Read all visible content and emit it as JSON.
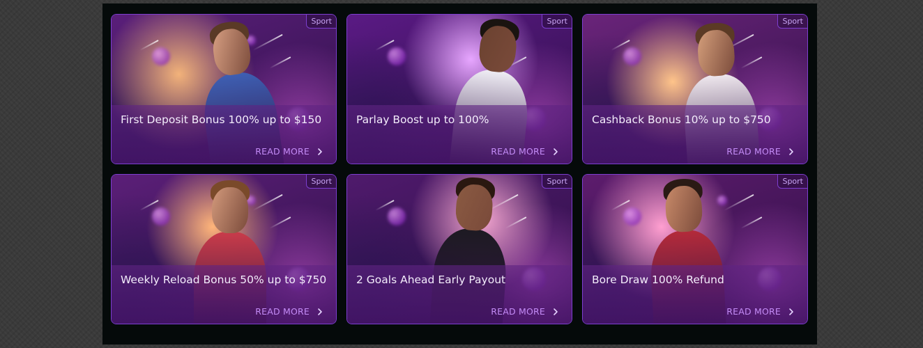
{
  "promotions": [
    {
      "tag": "Sport",
      "title": "First Deposit Bonus 100% up to $150",
      "cta": "READ MORE",
      "chevron_icon": "chevron-right-icon",
      "scene": "soccer player",
      "colors": {
        "bg": "#5a1f7a",
        "glow": "#f2b27a",
        "skin": "#d9a184",
        "jersey": "#3e5fb3",
        "hair": "#5a3a26"
      }
    },
    {
      "tag": "Sport",
      "title": "Parlay Boost up to 100%",
      "cta": "READ MORE",
      "chevron_icon": "chevron-right-icon",
      "scene": "basketball player",
      "colors": {
        "bg": "#5a1a84",
        "glow": "#e7a6ff",
        "skin": "#6b4230",
        "jersey": "#f0eef5",
        "hair": "#1a1410"
      }
    },
    {
      "tag": "Sport",
      "title": "Cashback Bonus 10% up to $750",
      "cta": "READ MORE",
      "chevron_icon": "chevron-right-icon",
      "scene": "tennis player",
      "colors": {
        "bg": "#6a247a",
        "glow": "#ffc48a",
        "skin": "#d6a07c",
        "jersey": "#efe8ee",
        "hair": "#5b3a25"
      }
    },
    {
      "tag": "Sport",
      "title": "Weekly Reload Bonus 50% up to $750",
      "cta": "READ MORE",
      "chevron_icon": "chevron-right-icon",
      "scene": "soccer player",
      "colors": {
        "bg": "#5b1f78",
        "glow": "#ffb57a",
        "skin": "#d39a7c",
        "jersey": "#c93b4a",
        "hair": "#7a4a2a"
      }
    },
    {
      "tag": "Sport",
      "title": "2 Goals Ahead Early Payout",
      "cta": "READ MORE",
      "chevron_icon": "chevron-right-icon",
      "scene": "football player",
      "colors": {
        "bg": "#4f1a6c",
        "glow": "#f5a7d0",
        "skin": "#8a5a42",
        "jersey": "#1d1a22",
        "hair": "#2a1810"
      }
    },
    {
      "tag": "Sport",
      "title": "Bore Draw 100% Refund",
      "cta": "READ MORE",
      "chevron_icon": "chevron-right-icon",
      "scene": "soccer fan",
      "colors": {
        "bg": "#5d1c6d",
        "glow": "#ff9fd0",
        "skin": "#c98b6a",
        "jersey": "#b42a3a",
        "hair": "#2a1a14"
      }
    }
  ]
}
